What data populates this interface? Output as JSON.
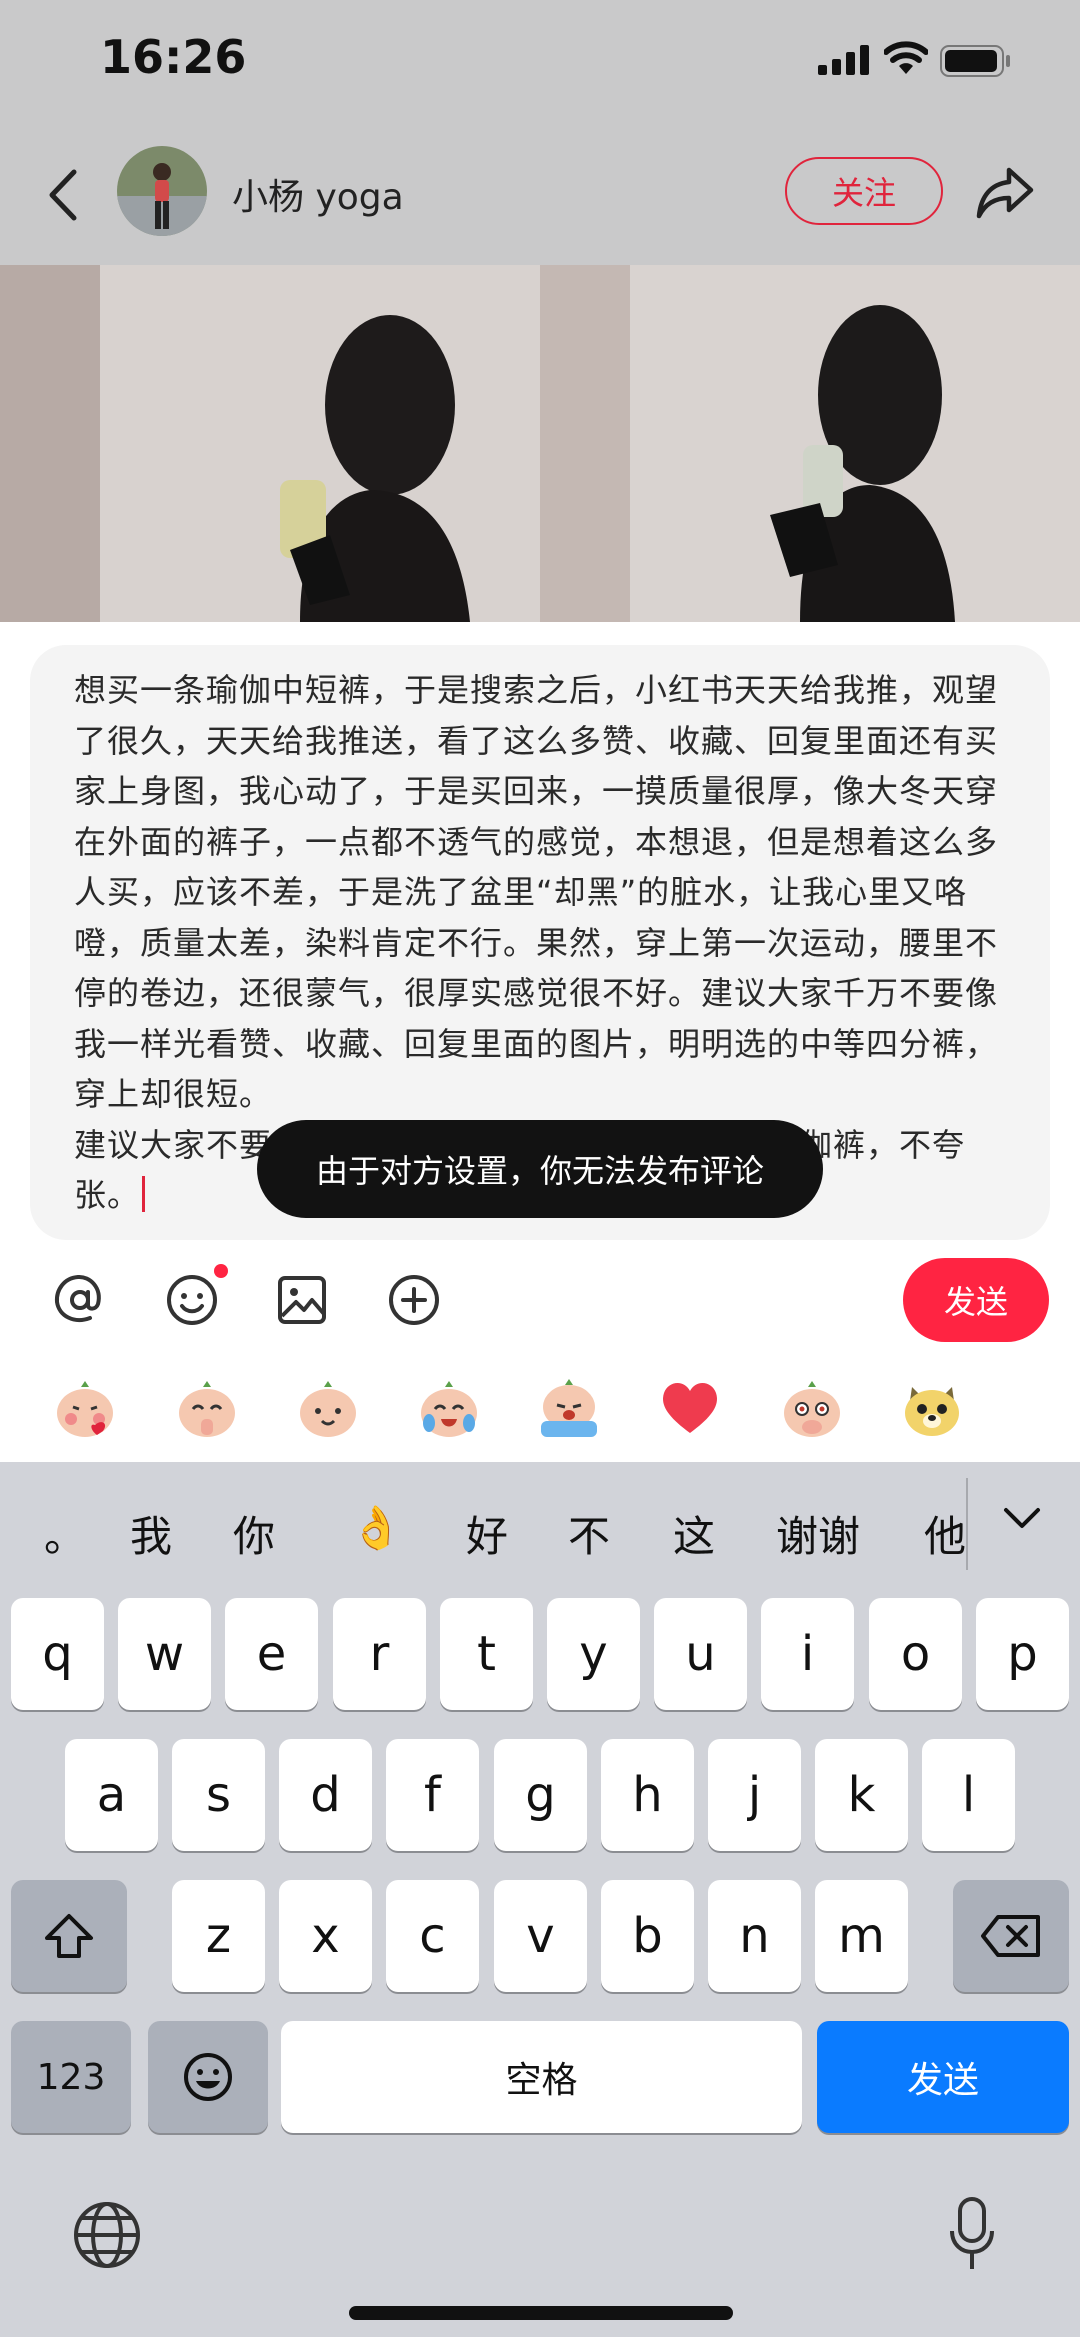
{
  "status": {
    "time": "16:26"
  },
  "header": {
    "username": "小杨 yoga",
    "follow_label": "关注"
  },
  "comment": {
    "paragraphs": [
      "想买一条瑜伽中短裤，于是搜索之后，小红书天天给我推，观望了很久，天天给我推送，看了这么多赞、收藏、回复里面还有买家上身图，我心动了，于是买回来，一摸质量很厚，像大冬天穿在外面的裤子，一点都不透气的感觉，本想退，但是想着这么多人买，应该不差，于是洗了盆里“却黑”的脏水，让我心里又咯噔，质量太差，染料肯定不行。果然，穿上第一次运动，腰里不停的卷边，还很蒙气，很厚实感觉很不好。建议大家千万不要像我一样光看赞、收藏、回复里面的图片，明明选的中等四分裤，穿上却很短。",
      "建议大家不要买，质量太差，像穿了十条厚度的瑜伽裤，不夸张。"
    ]
  },
  "toast": "由于对方设置，你无法发布评论",
  "toolbar": {
    "send_label": "发送",
    "tools": [
      "at-icon",
      "emoji-icon",
      "image-icon",
      "plus-icon"
    ]
  },
  "emojis": [
    "blush-kiss",
    "pray-happy",
    "smile",
    "cry-laugh",
    "sob",
    "heart",
    "cover-mouth",
    "dog-face"
  ],
  "keyboard": {
    "candidates": [
      "。",
      "我",
      "你",
      "👌",
      "好",
      "不",
      "这",
      "谢谢",
      "他"
    ],
    "row1": [
      "q",
      "w",
      "e",
      "r",
      "t",
      "y",
      "u",
      "i",
      "o",
      "p"
    ],
    "row2": [
      "a",
      "s",
      "d",
      "f",
      "g",
      "h",
      "j",
      "k",
      "l"
    ],
    "row3": [
      "z",
      "x",
      "c",
      "v",
      "b",
      "n",
      "m"
    ],
    "num_label": "123",
    "space_label": "空格",
    "send_label": "发送"
  },
  "colors": {
    "accent_red": "#ff2442",
    "keyboard_blue": "#0a7bff"
  }
}
